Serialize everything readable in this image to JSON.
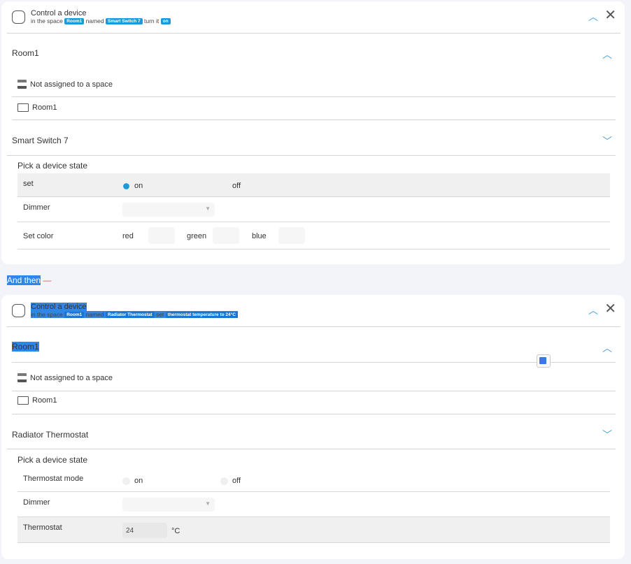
{
  "actions": [
    {
      "title": "Control a device",
      "sub": {
        "in_space": "in the space",
        "space": "Room1",
        "named": "named",
        "device": "Smart Switch 7",
        "verb": "turn it",
        "value": "on"
      },
      "space_section": "Room1",
      "spaces": [
        "Not assigned to a space",
        "Room1"
      ],
      "device_section": "Smart Switch 7",
      "pick_label": "Pick a device state",
      "rows": {
        "set_label": "set",
        "on": "on",
        "off": "off",
        "selected": "on",
        "dimmer": "Dimmer",
        "color_label": "Set color",
        "red": "red",
        "green": "green",
        "blue": "blue"
      }
    },
    {
      "title": "Control a device",
      "sub": {
        "in_space": "in the space",
        "space": "Room1",
        "named": "named",
        "device": "Radiator Thermostat",
        "verb": "set",
        "value": "thermostat temperature to 24°C"
      },
      "space_section": "Room1",
      "spaces": [
        "Not assigned to a space",
        "Room1"
      ],
      "device_section": "Radiator Thermostat",
      "pick_label": "Pick a device state",
      "rows": {
        "mode_label": "Thermostat mode",
        "on": "on",
        "off": "off",
        "dimmer": "Dimmer",
        "thermostat_label": "Thermostat",
        "thermostat_value": "24",
        "unit": "°C"
      }
    }
  ],
  "connector": "And then",
  "icons": {
    "collapse": "chevron-up-icon",
    "expand": "chevron-down-icon",
    "close": "close-icon",
    "translate": "google-translate-icon"
  },
  "accent": "#1a9ad6"
}
